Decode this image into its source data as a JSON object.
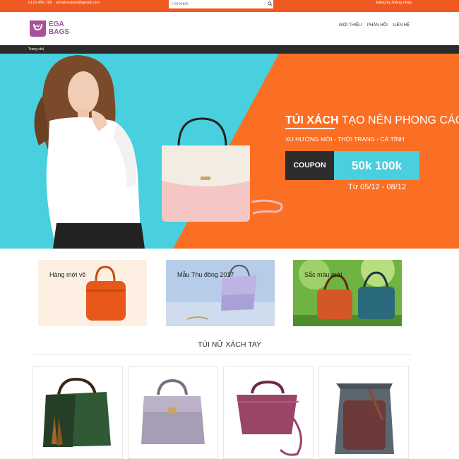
{
  "topbar": {
    "phone": "0123.456.789",
    "email": "emailcuaban@gmail.com",
    "search_placeholder": "Tìm kiếm",
    "account": "Đăng ký /Đăng nhập"
  },
  "header": {
    "logo_line1": "EGA",
    "logo_line2": "BAGS",
    "nav": [
      "GIỚI THIỆU",
      "PHẢN HỒI",
      "LIÊN HỆ"
    ]
  },
  "breadcrumb": {
    "home": "Trang chủ"
  },
  "hero": {
    "title_bold": "TÚI XÁCH",
    "title_rest": " TẠO NÊN PHONG CÁCH",
    "subtitle": "XU HƯỚNG MỚI - THỜI TRANG - CÁ TÍNH",
    "coupon_label": "COUPON",
    "coupon_value": "50k 100k",
    "dates": "Từ 05/12  -  08/12"
  },
  "categories": [
    {
      "label": "Hàng mới về"
    },
    {
      "label": "Mẫu Thu đông 2017"
    },
    {
      "label": "Sắc màu mới"
    }
  ],
  "section": {
    "title": "TÚI NỮ XÁCH TAY"
  },
  "colors": {
    "accent": "#f05a22",
    "hero_cyan": "#48d0df",
    "hero_orange": "#fb6f24",
    "logo_purple": "#a8509b"
  }
}
